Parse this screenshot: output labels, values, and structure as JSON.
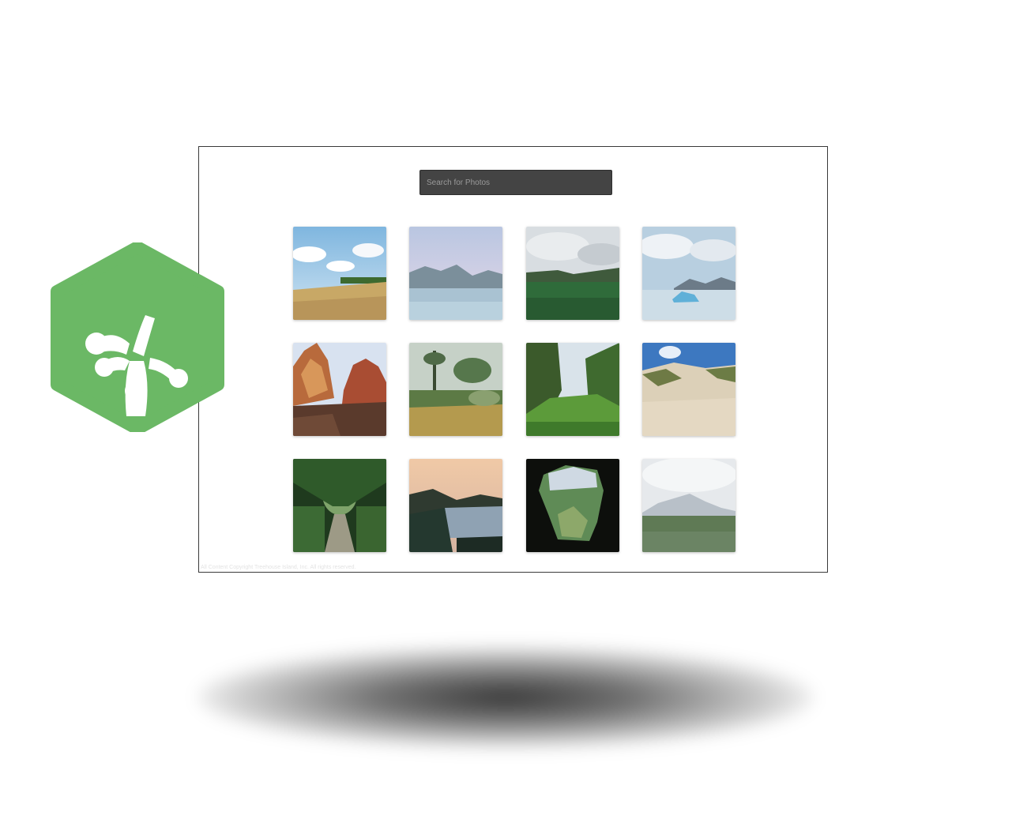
{
  "search": {
    "placeholder": "Search for Photos"
  },
  "gallery": {
    "photos": [
      {
        "name": "photo-wheat-field"
      },
      {
        "name": "photo-mountain-lake"
      },
      {
        "name": "photo-green-meadow-cloudy"
      },
      {
        "name": "photo-glacier-lagoon"
      },
      {
        "name": "photo-red-rock-canyon"
      },
      {
        "name": "photo-tropical-garden"
      },
      {
        "name": "photo-green-valley"
      },
      {
        "name": "photo-sand-dunes"
      },
      {
        "name": "photo-forest-path"
      },
      {
        "name": "photo-coastal-sunset"
      },
      {
        "name": "photo-cave-opening"
      },
      {
        "name": "photo-snowy-mountain-field"
      }
    ]
  },
  "footer": {
    "caption": "All Content Copyright Treehouse Island, Inc. All rights reserved."
  },
  "logo": {
    "icon": "treehouse-frog-foot-icon",
    "color": "#6BB865"
  }
}
